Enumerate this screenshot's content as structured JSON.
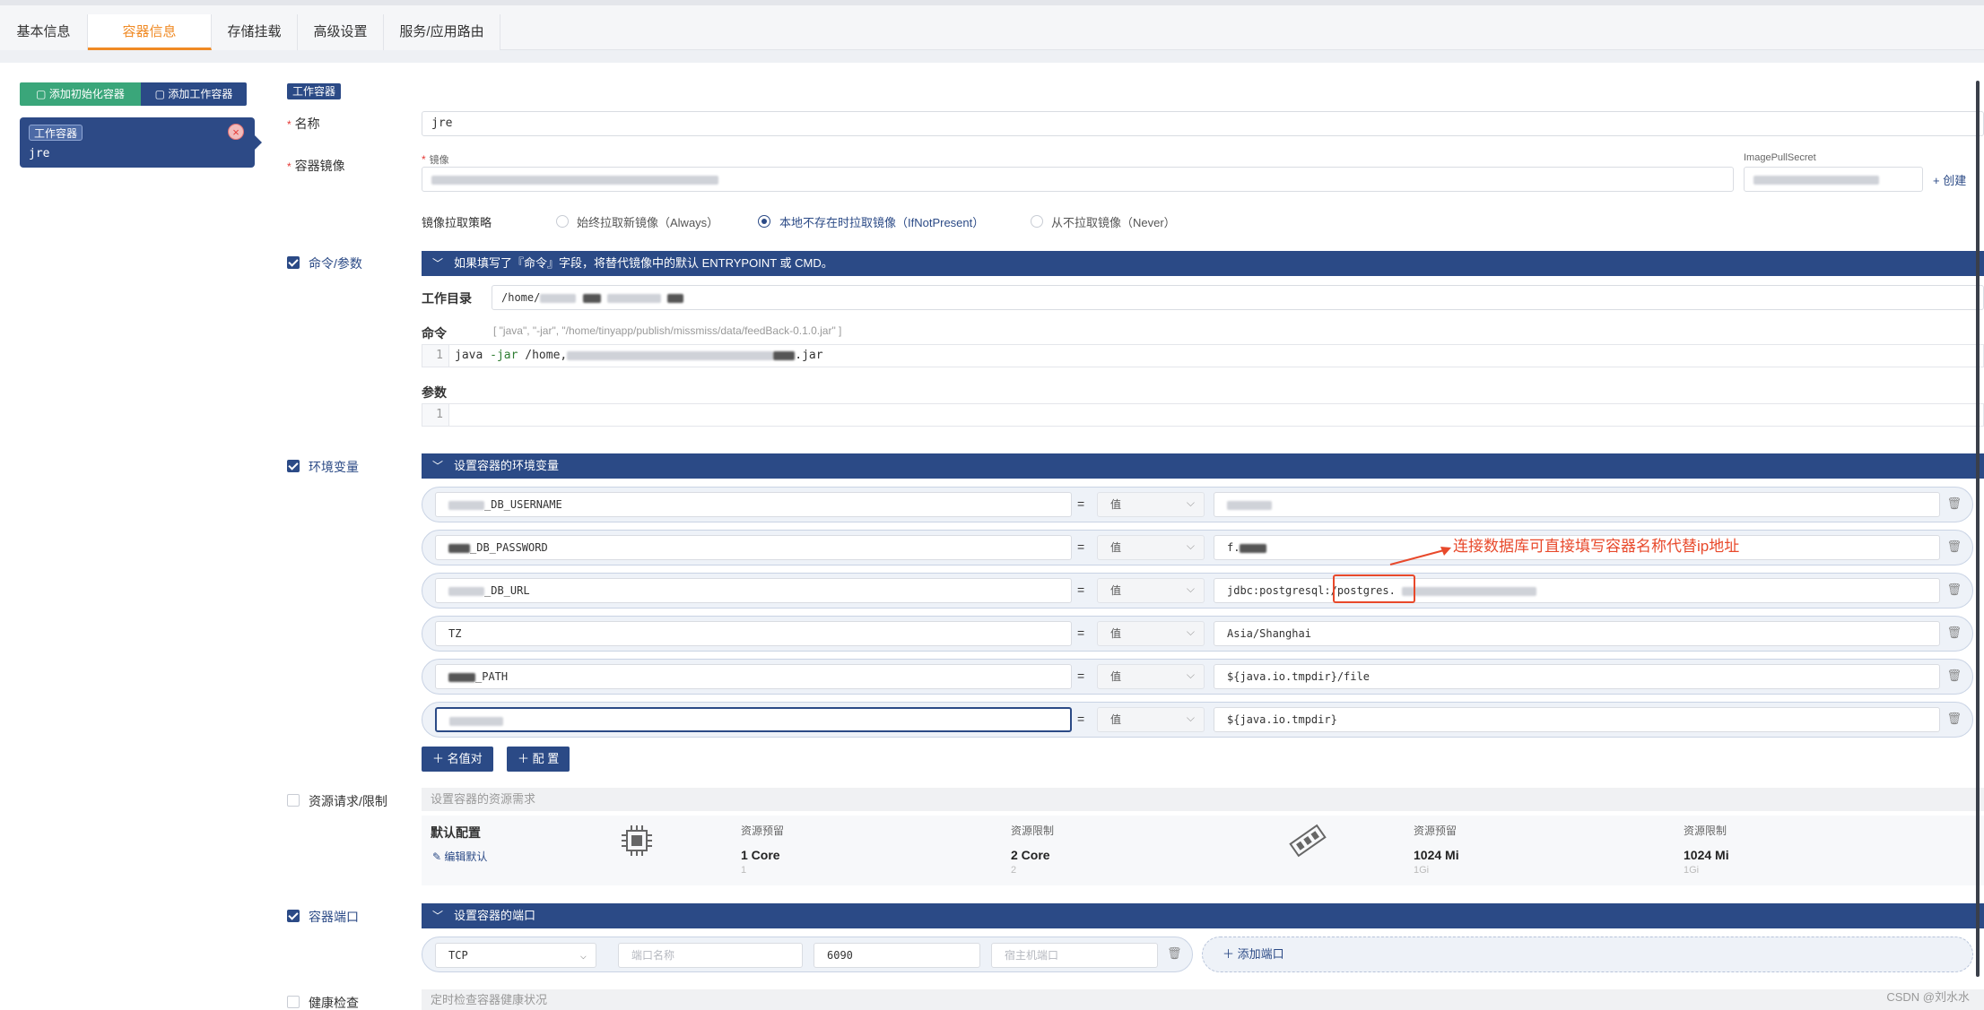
{
  "tabs": [
    {
      "label": "基本信息"
    },
    {
      "label": "容器信息"
    },
    {
      "label": "存储挂载"
    },
    {
      "label": "高级设置"
    },
    {
      "label": "服务/应用路由"
    }
  ],
  "left": {
    "add_init_label": "添加初始化容器",
    "add_work_label": "添加工作容器",
    "card_tag": "工作容器",
    "card_name": "jre"
  },
  "form": {
    "work_tag": "工作容器",
    "name_label": "名称",
    "name_value": "jre",
    "image_label": "容器镜像",
    "image_sub_label": "镜像",
    "pull_secret_label": "ImagePullSecret",
    "create_label": "创建",
    "pull_policy_label": "镜像拉取策略",
    "pull_options": [
      "始终拉取新镜像（Always）",
      "本地不存在时拉取镜像（IfNotPresent）",
      "从不拉取镜像（Never）"
    ],
    "cmd_section_label": "命令/参数",
    "cmd_bar_text": "如果填写了『命令』字段，将替代镜像中的默认 ENTRYPOINT 或 CMD。",
    "workdir_label": "工作目录",
    "workdir_value": "/home/",
    "command_label": "命令",
    "command_hint": "[ \"java\", \"-jar\", \"/home/tinyapp/publish/missmiss/data/feedBack-0.1.0.jar\" ]",
    "command_line_no": "1",
    "command_code_pre": "java ",
    "command_code_kw": "-jar",
    "command_code_post": " /home,",
    "command_code_tail": ".jar",
    "args_label": "参数",
    "args_line_no": "1"
  },
  "env": {
    "section_label": "环境变量",
    "bar_text": "设置容器的环境变量",
    "eq": "=",
    "type_label": "值",
    "rows": [
      {
        "key": "_DB_USERNAME",
        "value": ""
      },
      {
        "key": "_DB_PASSWORD",
        "value": "f."
      },
      {
        "key": "_DB_URL",
        "value": "jdbc:postgresql:/postgres."
      },
      {
        "key": "TZ",
        "value": "Asia/Shanghai"
      },
      {
        "key": "_PATH",
        "value": "${java.io.tmpdir}/file"
      },
      {
        "key": "",
        "value": "${java.io.tmpdir}"
      }
    ],
    "add_pair_label": "名值对",
    "add_config_label": "配 置",
    "annotation": "连接数据库可直接填写容器名称代替ip地址"
  },
  "resources": {
    "section_label": "资源请求/限制",
    "bar_text": "设置容器的资源需求",
    "default_label": "默认配置",
    "edit_default_label": "编辑默认",
    "cpu": {
      "reserve_label": "资源预留",
      "reserve_value": "1 Core",
      "reserve_sub": "1",
      "limit_label": "资源限制",
      "limit_value": "2 Core",
      "limit_sub": "2"
    },
    "mem": {
      "reserve_label": "资源预留",
      "reserve_value": "1024 Mi",
      "reserve_sub": "1Gi",
      "limit_label": "资源限制",
      "limit_value": "1024 Mi",
      "limit_sub": "1Gi"
    }
  },
  "ports": {
    "section_label": "容器端口",
    "bar_text": "设置容器的端口",
    "protocol": "TCP",
    "name_placeholder": "端口名称",
    "port_value": "6090",
    "host_placeholder": "宿主机端口",
    "add_port_label": "添加端口"
  },
  "health": {
    "section_label": "健康检查",
    "bar_text": "定时检查容器健康状况"
  },
  "watermark": "CSDN @刘水水"
}
